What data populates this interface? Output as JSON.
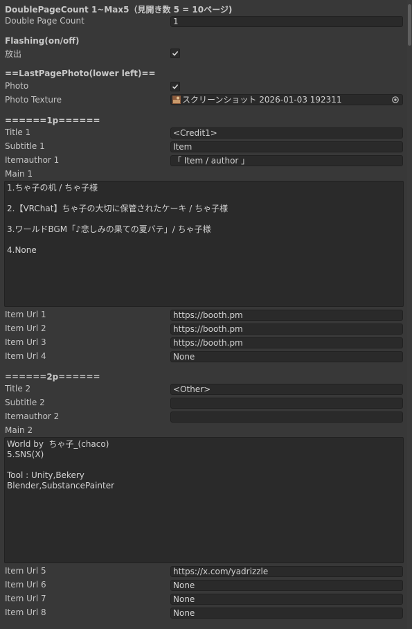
{
  "section_doublepage": {
    "header": "DoublePageCount 1~Max5（見開き数 5 = 10ページ)",
    "label": "Double Page Count",
    "value": "1"
  },
  "section_flashing": {
    "header": "Flashing(on/off)",
    "label": "放出",
    "checked": true
  },
  "section_lastpage": {
    "header": "==LastPagePhoto(lower left)==",
    "photo_label": "Photo",
    "photo_checked": true,
    "texture_label": "Photo Texture",
    "texture_value": "スクリーンショット 2026-01-03 192311",
    "picker_icon": "object-picker-icon",
    "thumb_icon": "image-thumbnail-icon"
  },
  "page1": {
    "header": "======1p======",
    "title_label": "Title 1",
    "title_value": "<Credit1>",
    "subtitle_label": "Subtitle 1",
    "subtitle_value": "Item",
    "itemauthor_label": "Itemauthor 1",
    "itemauthor_value": "「 Item  /  author 」",
    "main_label": "Main 1",
    "main_value": "1.ちゃ子の机 / ちゃ子様\n\n2.【VRChat】ちゃ子の大切に保管されたケーキ / ちゃ子様\n\n3.ワールドBGM「♪悲しみの果ての夏バテ」/ ちゃ子様\n\n4.None",
    "urls": [
      {
        "label": "Item Url 1",
        "value": "https://booth.pm"
      },
      {
        "label": "Item Url 2",
        "value": "https://booth.pm"
      },
      {
        "label": "Item Url 3",
        "value": "https://booth.pm"
      },
      {
        "label": "Item Url 4",
        "value": "None"
      }
    ]
  },
  "page2": {
    "header": "======2p======",
    "title_label": "Title 2",
    "title_value": "<Other>",
    "subtitle_label": "Subtitle 2",
    "subtitle_value": "",
    "itemauthor_label": "Itemauthor 2",
    "itemauthor_value": "",
    "main_label": "Main 2",
    "main_value": "World by  ちゃ子_(chaco)\n5.SNS(X)\n\nTool : Unity,Bekery\nBlender,SubstancePainter",
    "urls": [
      {
        "label": "Item Url 5",
        "value": "https://x.com/yadrizzle"
      },
      {
        "label": "Item Url 6",
        "value": "None"
      },
      {
        "label": "Item Url 7",
        "value": "None"
      },
      {
        "label": "Item Url 8",
        "value": "None"
      }
    ]
  },
  "colors": {
    "background": "#383838",
    "field": "#2a2a2a",
    "text": "#c4c4c4"
  }
}
